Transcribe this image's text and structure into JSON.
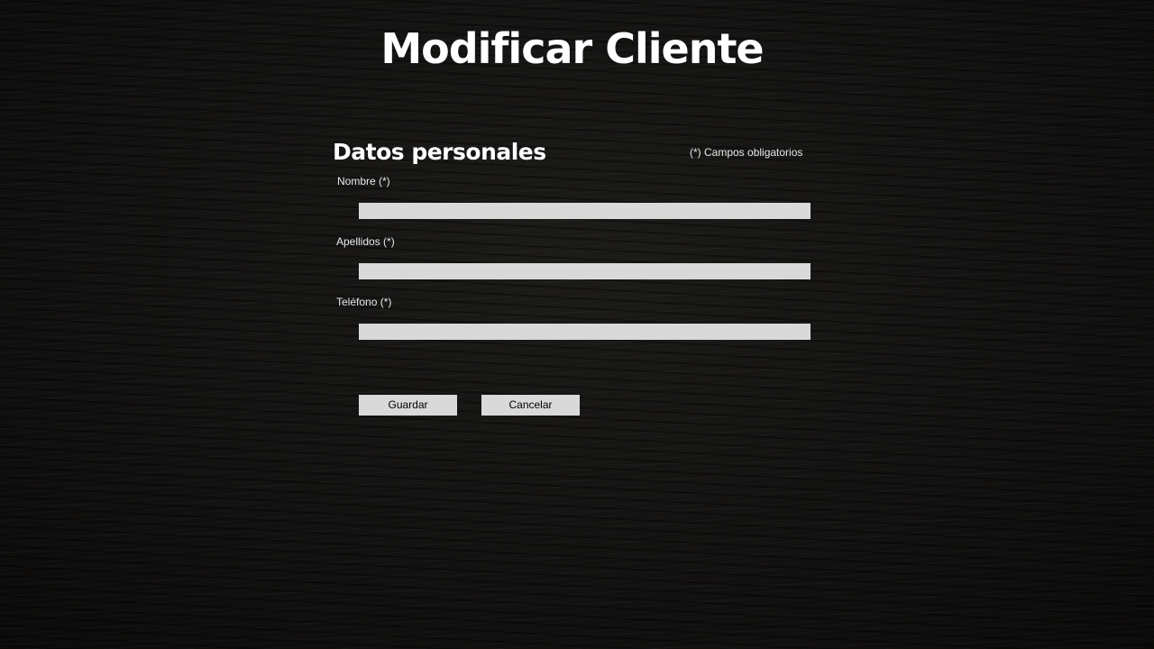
{
  "page": {
    "title": "Modificar Cliente"
  },
  "form": {
    "section_title": "Datos personales",
    "required_note": "(*) Campos obligatorios",
    "fields": [
      {
        "label": "Nombre (*)",
        "value": ""
      },
      {
        "label": "Apellidos (*)",
        "value": ""
      },
      {
        "label": "Teléfono (*)",
        "value": ""
      }
    ],
    "buttons": {
      "save_label": "Guardar",
      "cancel_label": "Cancelar"
    }
  },
  "colors": {
    "background": "#141311",
    "text": "#ffffff",
    "input_background": "#d9d9d9",
    "button_background": "#d9d9d9"
  }
}
